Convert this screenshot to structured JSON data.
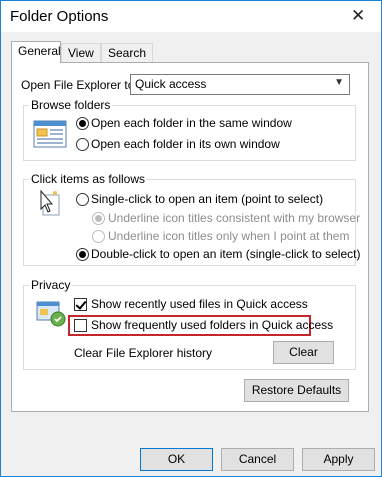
{
  "window": {
    "title": "Folder Options",
    "close_glyph": "✕"
  },
  "tabs": [
    {
      "label": "General",
      "active": true
    },
    {
      "label": "View",
      "active": false
    },
    {
      "label": "Search",
      "active": false
    }
  ],
  "general": {
    "open_explorer_label": "Open File Explorer to:",
    "open_explorer_value": "Quick access",
    "browse_group": {
      "title": "Browse folders",
      "option_same": "Open each folder in the same window",
      "option_own": "Open each folder in its own window",
      "selected": "same"
    },
    "click_group": {
      "title": "Click items as follows",
      "single_click": "Single-click to open an item (point to select)",
      "underline_consistent": "Underline icon titles consistent with my browser",
      "underline_point": "Underline icon titles only when I point at them",
      "double_click": "Double-click to open an item (single-click to select)",
      "selected": "double"
    },
    "privacy_group": {
      "title": "Privacy",
      "show_recent_files": "Show recently used files in Quick access",
      "show_recent_files_checked": true,
      "show_frequent_folders": "Show frequently used folders in Quick access",
      "show_frequent_folders_checked": false,
      "clear_history_label": "Clear File Explorer history",
      "clear_button": "Clear"
    },
    "restore_defaults_button": "Restore Defaults"
  },
  "footer": {
    "ok": "OK",
    "cancel": "Cancel",
    "apply": "Apply"
  },
  "colors": {
    "accent": "#0078d7",
    "highlight_border": "#c4262e",
    "window_border": "#1883d7"
  },
  "icons": [
    "close-icon",
    "browse-folders-icon",
    "click-items-icon",
    "privacy-icon",
    "dropdown-arrow-icon"
  ]
}
